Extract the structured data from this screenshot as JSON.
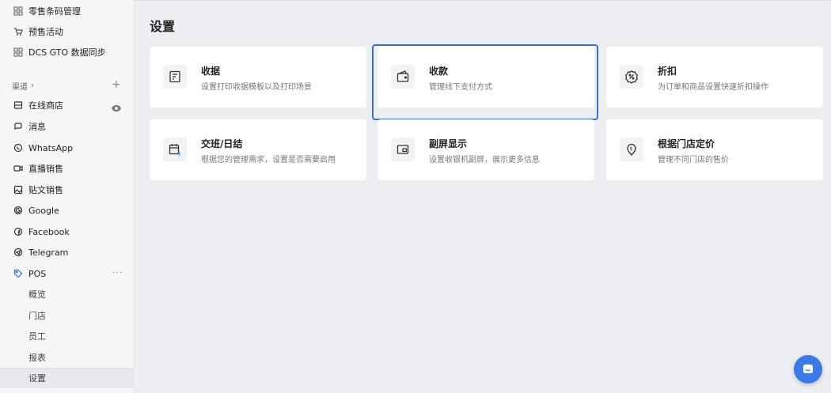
{
  "sidebar": {
    "top_items": [
      {
        "label": "零售条码管理",
        "icon": "barcode-grid-icon"
      },
      {
        "label": "预售活动",
        "icon": "presale-cart-icon"
      },
      {
        "label": "DCS GTO 数据同步",
        "icon": "sync-grid-icon"
      }
    ],
    "section_label": "渠道",
    "section_chevron": "›",
    "section_plus": "+",
    "channel_items": [
      {
        "label": "在线商店",
        "icon": "store-icon"
      },
      {
        "label": "消息",
        "icon": "message-icon"
      },
      {
        "label": "WhatsApp",
        "icon": "whatsapp-icon"
      },
      {
        "label": "直播销售",
        "icon": "live-video-icon"
      },
      {
        "label": "贴文销售",
        "icon": "post-image-icon"
      },
      {
        "label": "Google",
        "icon": "google-icon"
      },
      {
        "label": "Facebook",
        "icon": "facebook-icon"
      },
      {
        "label": "Telegram",
        "icon": "telegram-icon"
      },
      {
        "label": "POS",
        "icon": "pos-tag-icon"
      }
    ],
    "pos_more": "···",
    "pos_sub_items": [
      "概览",
      "门店",
      "员工",
      "报表",
      "设置"
    ],
    "active_sub": "设置"
  },
  "main": {
    "title": "设置",
    "cards": [
      {
        "title": "收据",
        "desc": "设置打印收据模板以及打印场景",
        "icon": "receipt-icon"
      },
      {
        "title": "收款",
        "desc": "管理线下支付方式",
        "icon": "wallet-icon"
      },
      {
        "title": "折扣",
        "desc": "为订单和商品设置快速折扣操作",
        "icon": "discount-badge-icon"
      },
      {
        "title": "交班/日结",
        "desc": "根据您的管理需求，设置是否需要启用",
        "icon": "shift-calendar-icon"
      },
      {
        "title": "副屏显示",
        "desc": "设置收银机副屏，展示更多信息",
        "icon": "second-screen-icon"
      },
      {
        "title": "根据门店定价",
        "desc": "管理不同门店的售价",
        "icon": "location-price-icon"
      }
    ],
    "selected_card": "收款"
  },
  "colors": {
    "accent": "#3b6fd8",
    "chat_button": "#3a7be8",
    "background": "#eceef2",
    "sidebar_bg": "#f5f6f8"
  }
}
